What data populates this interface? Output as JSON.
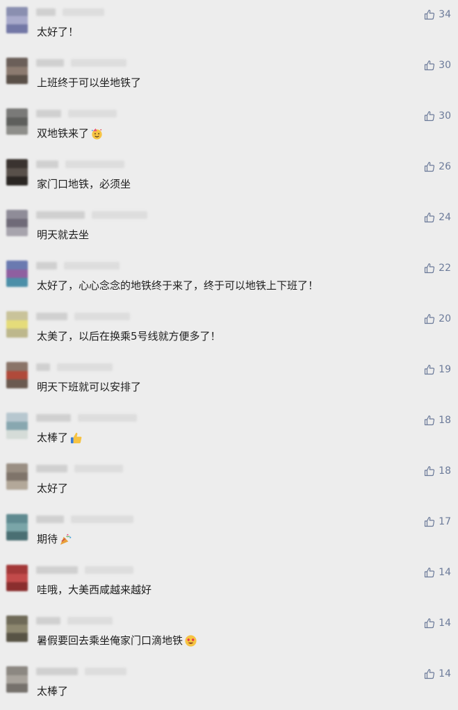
{
  "comments": [
    {
      "text": "太好了！",
      "likes": "34",
      "emoji": null,
      "avatar": [
        "#8a8fb0",
        "#a8aacb",
        "#7378a6"
      ]
    },
    {
      "text": "上班终于可以坐地铁了",
      "likes": "30",
      "emoji": null,
      "avatar": [
        "#6b5f59",
        "#8c7b70",
        "#5a5048"
      ]
    },
    {
      "text": "双地铁来了",
      "likes": "30",
      "emoji": "party-face",
      "avatar": [
        "#7a7a78",
        "#5e5f5c",
        "#8e8e8a"
      ]
    },
    {
      "text": "家门口地铁，必须坐",
      "likes": "26",
      "emoji": null,
      "avatar": [
        "#3a3330",
        "#58504a",
        "#2a2623"
      ]
    },
    {
      "text": "明天就去坐",
      "likes": "24",
      "emoji": null,
      "avatar": [
        "#8f8c98",
        "#6f6a78",
        "#a7a4ad"
      ]
    },
    {
      "text": "太好了，心心念念的地铁终于来了，终于可以地铁上下班了！",
      "likes": "22",
      "emoji": null,
      "avatar": [
        "#6a7ab0",
        "#8f5fa0",
        "#4c8fa8"
      ]
    },
    {
      "text": "太美了，以后在换乘5号线就方便多了！",
      "likes": "20",
      "emoji": null,
      "avatar": [
        "#c9c39a",
        "#e5dc7a",
        "#bdb78c"
      ]
    },
    {
      "text": "明天下班就可以安排了",
      "likes": "19",
      "emoji": null,
      "avatar": [
        "#8a7468",
        "#b04a3a",
        "#6b5a50"
      ]
    },
    {
      "text": "太棒了",
      "likes": "18",
      "emoji": "thumbs-up",
      "avatar": [
        "#b7c7cf",
        "#88a7b0",
        "#d5dcd8"
      ]
    },
    {
      "text": "太好了",
      "likes": "18",
      "emoji": null,
      "avatar": [
        "#9a8f83",
        "#7f746a",
        "#b3a899"
      ]
    },
    {
      "text": "期待",
      "likes": "17",
      "emoji": "party-popper",
      "avatar": [
        "#5f8a90",
        "#7aa5a8",
        "#4a6f73"
      ]
    },
    {
      "text": "哇哦，大美西咸越来越好",
      "likes": "14",
      "emoji": null,
      "avatar": [
        "#a33838",
        "#c24a4a",
        "#8a2e2e"
      ]
    },
    {
      "text": "暑假要回去乘坐俺家门口滴地铁",
      "likes": "14",
      "emoji": "heart-eyes",
      "avatar": [
        "#6f6a58",
        "#8d876f",
        "#585345"
      ]
    },
    {
      "text": "太棒了",
      "likes": "14",
      "emoji": null,
      "avatar": [
        "#8c8882",
        "#a8a39c",
        "#75716c"
      ]
    }
  ],
  "colors": {
    "background": "#ededed",
    "text": "#1e1e1e",
    "like": "#6b7a99"
  }
}
